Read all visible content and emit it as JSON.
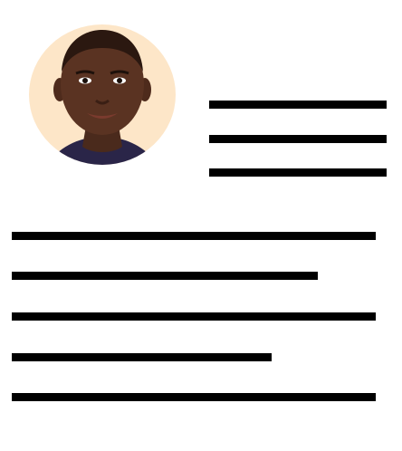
{
  "profile": {
    "avatar_icon": "person-portrait",
    "avatar_background": "#fde6c8"
  },
  "placeholder_lines": {
    "color": "#000000",
    "header_count": 3,
    "body_count": 5
  }
}
